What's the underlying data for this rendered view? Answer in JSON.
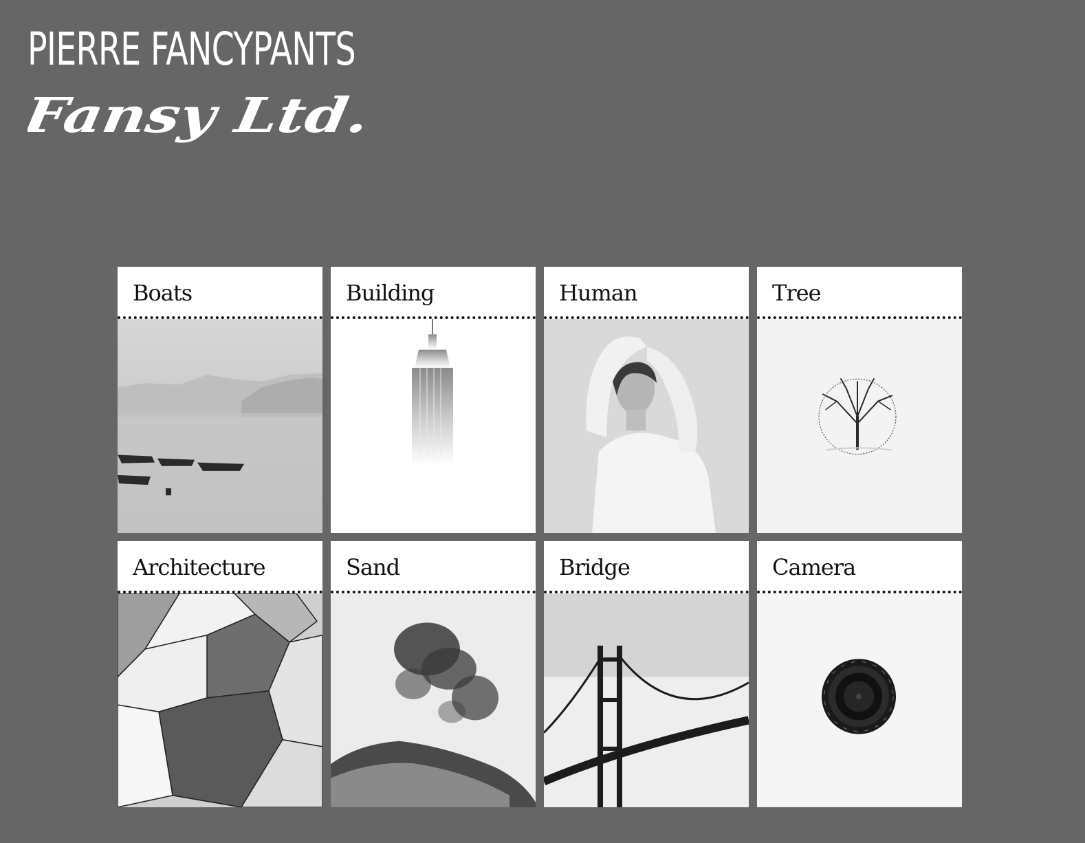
{
  "header": {
    "site_name": "PIERRE FANCYPANTS",
    "logo_text": "Fansy Ltd."
  },
  "gallery": {
    "cards": [
      {
        "title": "Boats",
        "image": "boats-photo"
      },
      {
        "title": "Building",
        "image": "building-photo"
      },
      {
        "title": "Human",
        "image": "human-photo"
      },
      {
        "title": "Tree",
        "image": "tree-photo"
      },
      {
        "title": "Architecture",
        "image": "architecture-photo"
      },
      {
        "title": "Sand",
        "image": "sand-photo"
      },
      {
        "title": "Bridge",
        "image": "bridge-photo"
      },
      {
        "title": "Camera",
        "image": "camera-photo"
      }
    ]
  },
  "colors": {
    "page_background": "#666666",
    "card_background": "#ffffff",
    "text_light": "#ffffff",
    "text_dark": "#111111"
  }
}
